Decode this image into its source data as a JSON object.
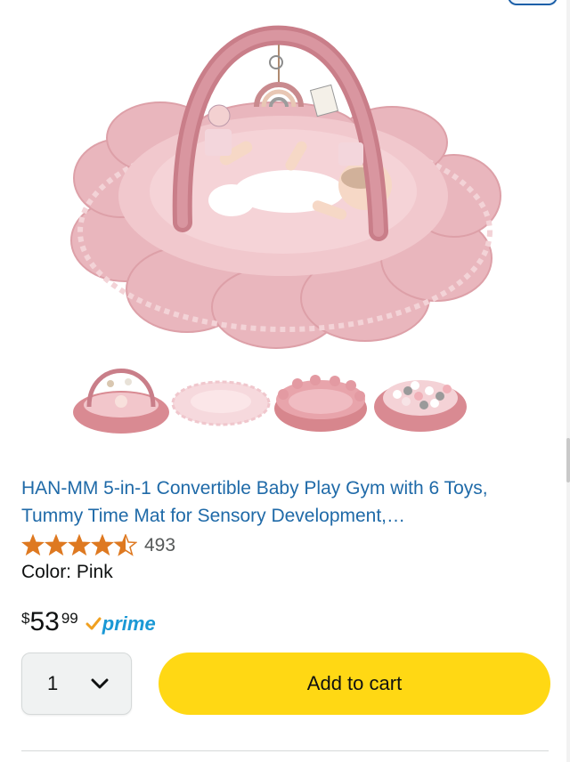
{
  "product": {
    "title": "HAN-MM 5-in-1 Convertible Baby Play Gym with 6 Toys, Tummy Time Mat for Sensory Development,…",
    "rating_value": 4.5,
    "rating_count": "493",
    "color_label": "Color: Pink",
    "price": {
      "symbol": "$",
      "whole": "53",
      "fraction": "99"
    },
    "prime_label": "prime",
    "images": {
      "main": "pink flower-shaped baby play gym with arch and infant",
      "thumbnails": [
        "play gym with arch",
        "flat round mat",
        "round pink nest with petal edge",
        "nest filled with ball pit balls"
      ]
    }
  },
  "purchase": {
    "quantity": "1",
    "add_to_cart_label": "Add to cart"
  },
  "colors": {
    "title_link": "#1f6aa8",
    "star": "#de7921",
    "prime": "#1a98d5",
    "cart_button": "#ffd814"
  },
  "icons": {
    "quantity_dropdown": "chevron-down-icon",
    "prime_check": "prime-check-icon"
  }
}
